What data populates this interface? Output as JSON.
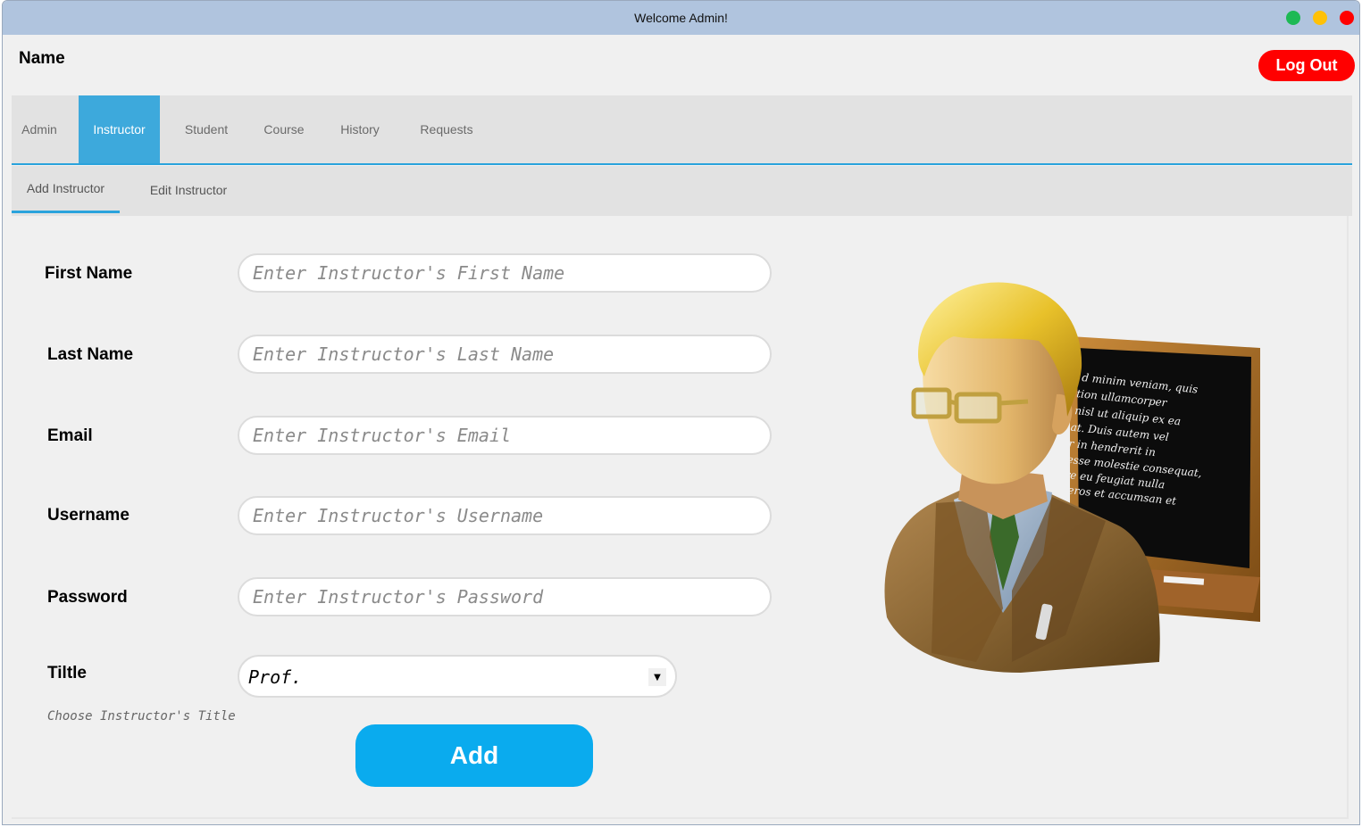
{
  "window": {
    "title": "Welcome Admin!",
    "controls": [
      {
        "name": "maximize",
        "color": "#1db954"
      },
      {
        "name": "minimize",
        "color": "#ffc107"
      },
      {
        "name": "close",
        "color": "#ff0000"
      }
    ]
  },
  "header": {
    "name_label": "Name",
    "logout_label": "Log Out"
  },
  "main_tabs": [
    {
      "label": "Admin",
      "active": false
    },
    {
      "label": "Instructor",
      "active": true
    },
    {
      "label": "Student",
      "active": false
    },
    {
      "label": "Course",
      "active": false
    },
    {
      "label": "History",
      "active": false
    },
    {
      "label": "Requests",
      "active": false
    }
  ],
  "sub_tabs": [
    {
      "label": "Add Instructor",
      "active": true
    },
    {
      "label": "Edit Instructor",
      "active": false
    }
  ],
  "form": {
    "first_name": {
      "label": "First Name",
      "placeholder": "Enter Instructor's First Name",
      "value": ""
    },
    "last_name": {
      "label": "Last Name",
      "placeholder": "Enter Instructor's Last Name",
      "value": ""
    },
    "email": {
      "label": "Email",
      "placeholder": "Enter Instructor's Email",
      "value": ""
    },
    "username": {
      "label": "Username",
      "placeholder": "Enter Instructor's Username",
      "value": ""
    },
    "password": {
      "label": "Password",
      "placeholder": "Enter Instructor's Password",
      "value": ""
    },
    "title": {
      "label": "Tiltle",
      "selected": "Prof.",
      "hint": "Choose Instructor's Title"
    },
    "add_label": "Add"
  },
  "illustration": {
    "icon": "teacher-with-chalkboard",
    "chalkboard_lines": [
      "d minim veniam, quis",
      "tion ullamcorper",
      "nisl ut aliquip ex ea",
      "quat. Duis autem vel",
      "olor in hendrerit in",
      "lit esse molestie consequat,",
      "ore eu feugiat nulla",
      "eros et accumsan et"
    ]
  },
  "colors": {
    "titlebar": "#b0c4de",
    "accent": "#3da9dc",
    "logout": "#ff0000",
    "add_button": "#0aabee"
  }
}
